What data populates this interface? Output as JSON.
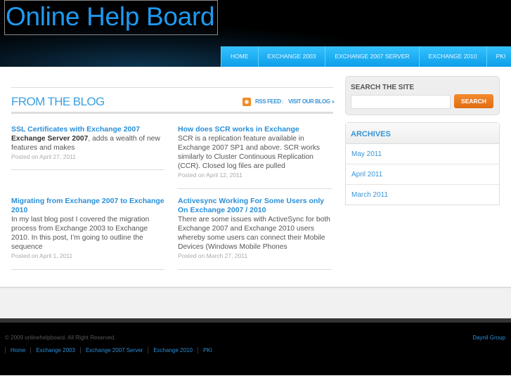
{
  "header": {
    "logo": "Online Help Board"
  },
  "nav": [
    "HOME",
    "EXCHANGE 2003",
    "EXCHANGE 2007 SERVER",
    "EXCHANGE 2010",
    "PKI"
  ],
  "blog": {
    "title": "FROM THE BLOG",
    "rss_label": "RSS FEED",
    "visit_label": "VISIT OUR BLOG »",
    "posts": [
      {
        "title": "SSL Certificates with Exchange 2007",
        "lead_bold": "Exchange Server 2007",
        "body": ", adds a wealth of new features and makes",
        "date": "Posted on April 27, 2011"
      },
      {
        "title": "How does SCR works in Exchange",
        "lead_bold": "",
        "body": "SCR is a replication feature available in Exchange 2007 SP1 and above. SCR works similarly to Cluster Continuous Replication (CCR). Closed log files are pulled",
        "date": "Posted on April 12, 2011"
      },
      {
        "title": "Migrating from Exchange 2007 to Exchange 2010",
        "lead_bold": "",
        "body": "In my last blog post I covered the migration process from Exchange 2003 to Exchange 2010.  In this post, I’m going to outline the sequence",
        "date": "Posted on April 1, 2011"
      },
      {
        "title": "Activesync Working For Some Users only On Exchange 2007 / 2010",
        "lead_bold": "",
        "body": "There are some issues with ActiveSync for both Exchange 2007 and Exchange 2010 users whereby some users can connect their Mobile Devices (Windows Mobile Phones",
        "date": "Posted on March 27, 2011"
      }
    ]
  },
  "search": {
    "label": "SEARCH THE SITE",
    "value": "",
    "button": "SEARCH"
  },
  "archives": {
    "title": "ARCHIVES",
    "items": [
      "May 2011",
      "April 2011",
      "March 2011"
    ]
  },
  "footer": {
    "copyright": "© 2009 onlinehelpboard. All Right Reserved.",
    "credit": "Daynil Group",
    "links": [
      "Home",
      "Exchange 2003",
      "Exchange 2007 Server",
      "Exchange 2010",
      "PKI"
    ]
  }
}
